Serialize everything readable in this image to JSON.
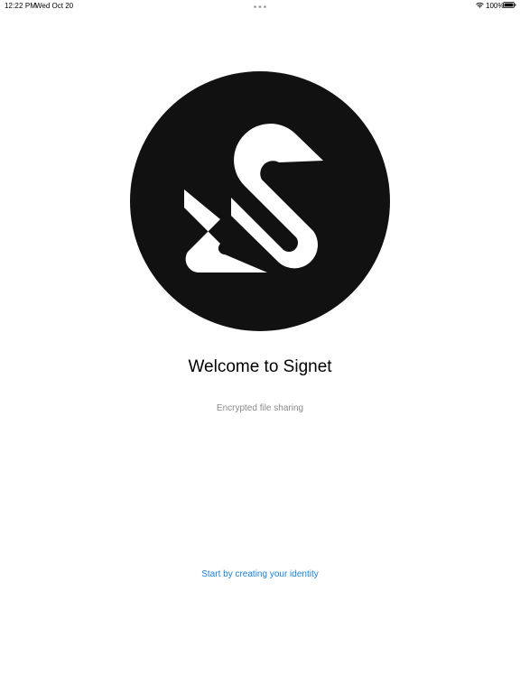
{
  "status_bar": {
    "time": "12:22 PM",
    "date": "Wed Oct 20",
    "battery": "100%",
    "icons": [
      "multitask-dots-icon",
      "wifi-icon",
      "battery-icon"
    ]
  },
  "logo": {
    "icon": "signet-logo",
    "background_color": "#111111",
    "mark_color": "#ffffff"
  },
  "welcome": {
    "title": "Welcome to Signet",
    "subtitle": "Encrypted file sharing"
  },
  "actions": {
    "start_label": "Start by creating your identity",
    "link_color": "#1a7fd8"
  }
}
